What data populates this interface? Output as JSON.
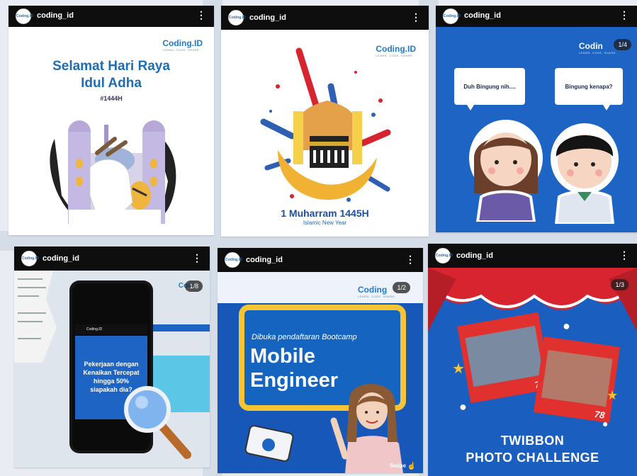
{
  "colors": {
    "header_bg": "#0e0e0e",
    "brand_blue": "#1c6db3",
    "accent_yellow": "#f7c433",
    "twibbon_red": "#d7242e"
  },
  "posts": [
    {
      "username": "coding_id",
      "avatar_text": "Coding.ID",
      "logo": "Coding.ID",
      "logo_tag": "LEARN. CODE. SHARE",
      "title_line1": "Selamat Hari Raya",
      "title_line2": "Idul Adha",
      "subtitle": "#1444H"
    },
    {
      "username": "coding_id",
      "avatar_text": "Coding.ID",
      "logo": "Coding.ID",
      "logo_tag": "LEARN. CODE. SHARE",
      "title": "1 Muharram 1445H",
      "subtitle": "Islamic New Year"
    },
    {
      "username": "coding_id",
      "avatar_text": "Coding.ID",
      "logo": "Codin",
      "logo_tag": "LEARN. CODE. SHARE",
      "page_indicator": "1/4",
      "bubble_left": "Duh Bingung nih....",
      "bubble_right": "Bingung kenapa?"
    },
    {
      "username": "coding_id",
      "avatar_text": "Coding.ID",
      "logo": "Codi",
      "page_indicator": "1/8",
      "phone_username": "Coding.ID",
      "phone_text": "Pekerjaan dengan Kenaikan Tercepat hingga 50% siapakah dia?"
    },
    {
      "username": "coding_id",
      "avatar_text": "Coding.ID",
      "logo": "Coding",
      "logo_tag": "LEARN. CODE. SHARE",
      "page_indicator": "1/2",
      "line1": "Dibuka pendaftaran Bootcamp",
      "line2": "Mobile",
      "line3": "Engineer",
      "swipe": "Swipe"
    },
    {
      "username": "coding_id",
      "avatar_text": "Coding.ID",
      "page_indicator": "1/3",
      "title_line1": "TWIBBON",
      "title_line2": "PHOTO CHALLENGE",
      "frame_number": "78"
    }
  ]
}
